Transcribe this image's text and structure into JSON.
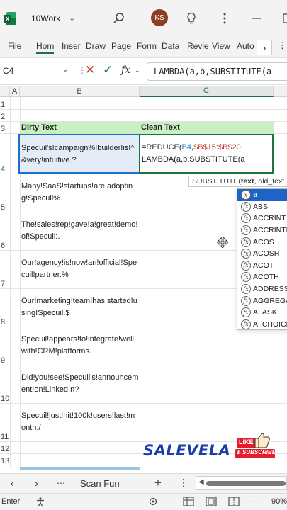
{
  "app": {
    "document_name": "10Work",
    "avatar_initials": "KS",
    "brand_color": "#1e7145"
  },
  "ribbon": {
    "tabs": [
      "File",
      "Hom",
      "Inser",
      "Draw",
      "Page",
      "Form",
      "Data",
      "Revie",
      "View",
      "Auto"
    ],
    "active_tab": "Hom"
  },
  "formula_bar": {
    "name_box": "C4",
    "formula": "LAMBDA(a,b,SUBSTITUTE(a"
  },
  "grid": {
    "columns": [
      "A",
      "B",
      "C"
    ],
    "active_column": "C",
    "rows": [
      "1",
      "2",
      "3",
      "4",
      "5",
      "6",
      "7",
      "8",
      "9",
      "10",
      "11",
      "12",
      "13"
    ],
    "header_b": "Dirty Text",
    "header_c": "Clean Text",
    "dirty_text": [
      "Specuil's!campaign%!builder!is!^&very!intuitive.?",
      "Many!SaaS!startups!are!adopting!Specuil%.",
      "The!sales!rep!gave!a!great!demo!of!Specuil:.",
      "Our!agency!is!now!an!official!Specuil!partner.%",
      "Our!marketing!team!has!started!using!Specuil.$",
      "Specuil!appears!to!integrate!well!with!CRM!platforms.",
      "Did!you!see!Specuil's!announcement!on!LinkedIn?",
      "Specuil!just!hit!100k!users!last!month./"
    ],
    "edit_cell": {
      "eq": "=REDUCE(",
      "ref1": "B4",
      "sep": ",",
      "ref2": "$B$15:$B$20",
      "tail": ",",
      "line2": "LAMBDA(a,b,SUBSTITUTE(a"
    }
  },
  "tooltip": {
    "func": "SUBSTITUTE(",
    "bold_arg": "text",
    "rest": ", old_text"
  },
  "autocomplete": {
    "items": [
      "a",
      "ABS",
      "ACCRINT",
      "ACCRINTM",
      "ACOS",
      "ACOSH",
      "ACOT",
      "ACOTH",
      "ADDRESS",
      "AGGREGATE",
      "AI.ASK",
      "AI.CHOICE"
    ],
    "selected_index": 0
  },
  "watermark": {
    "logo": "SALEVELA",
    "badge_top": "LIKE",
    "badge_bottom": "& SUBSCRIBE"
  },
  "sheet_tabs": {
    "active_sheet": "Scan Fun"
  },
  "status_bar": {
    "mode": "Enter",
    "zoom": "90%"
  }
}
